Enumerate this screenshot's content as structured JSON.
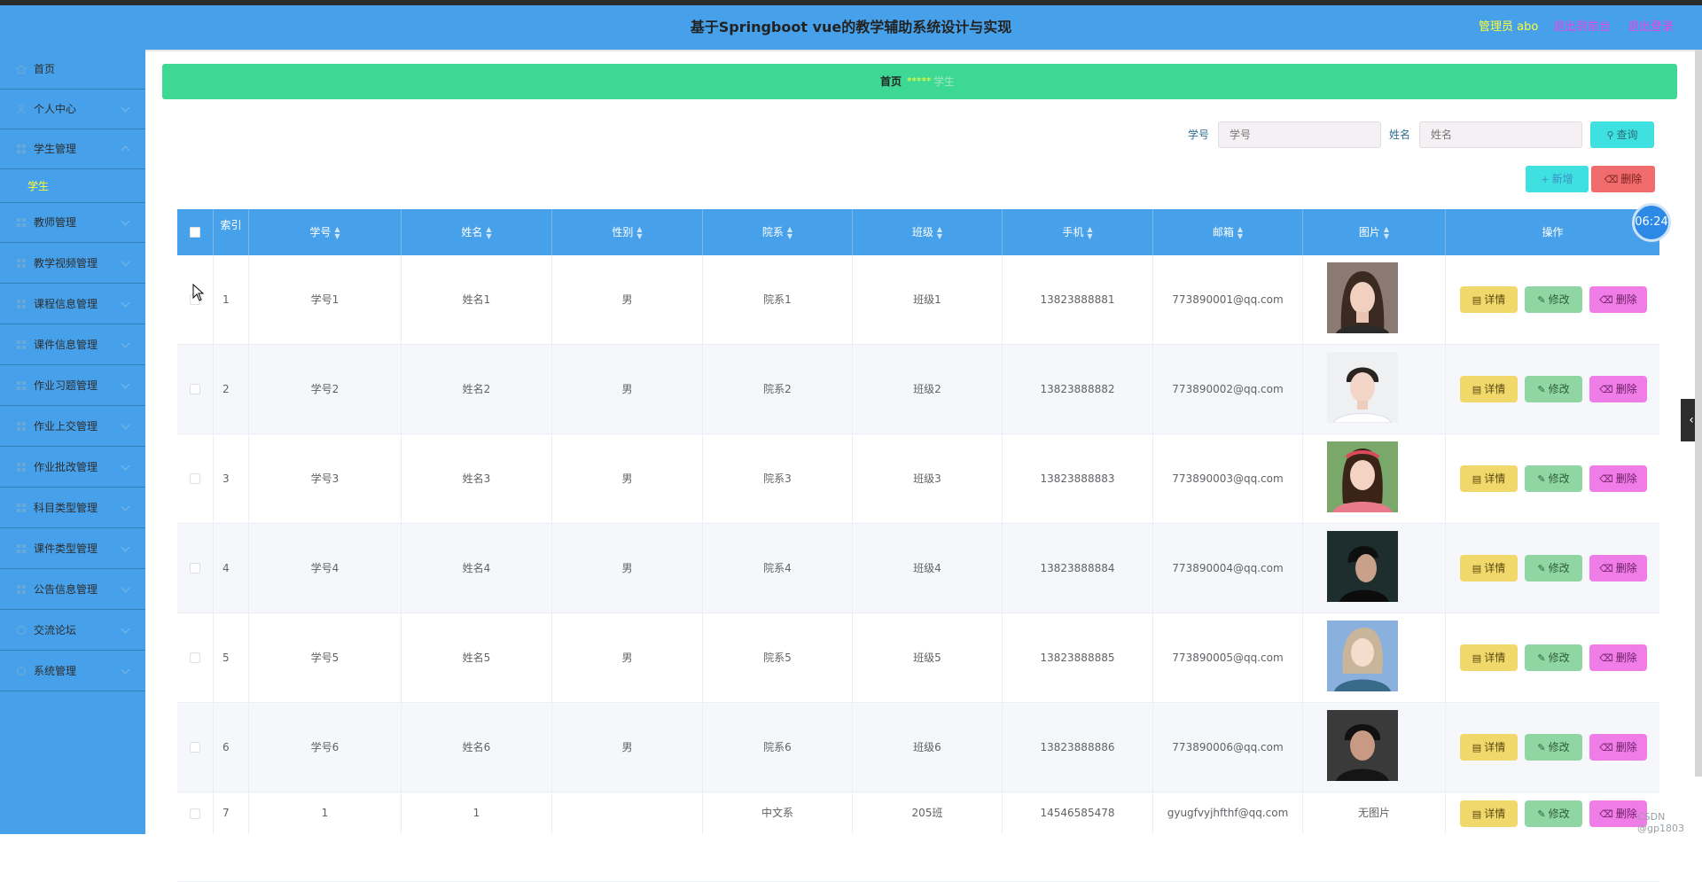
{
  "header": {
    "title": "基于Springboot vue的教学辅助系统设计与实现",
    "admin": "管理员 abo",
    "back_front": "退出到前台",
    "logout": "退出登录"
  },
  "sidebar": {
    "items": [
      {
        "label": "首页",
        "icon": "home-icon"
      },
      {
        "label": "个人中心",
        "icon": "user-icon"
      },
      {
        "label": "学生管理",
        "icon": "grid-icon"
      },
      {
        "label": "教师管理",
        "icon": "grid-icon"
      },
      {
        "label": "教学视频管理",
        "icon": "grid-icon"
      },
      {
        "label": "课程信息管理",
        "icon": "grid-icon"
      },
      {
        "label": "课件信息管理",
        "icon": "grid-icon"
      },
      {
        "label": "作业习题管理",
        "icon": "grid-icon"
      },
      {
        "label": "作业上交管理",
        "icon": "grid-icon"
      },
      {
        "label": "作业批改管理",
        "icon": "grid-icon"
      },
      {
        "label": "科目类型管理",
        "icon": "grid-icon"
      },
      {
        "label": "课件类型管理",
        "icon": "grid-icon"
      },
      {
        "label": "公告信息管理",
        "icon": "grid-icon"
      },
      {
        "label": "交流论坛",
        "icon": "grid-icon"
      },
      {
        "label": "系统管理",
        "icon": "grid-icon"
      }
    ],
    "sub_item": "学生"
  },
  "breadcrumb": {
    "home": "首页",
    "separator": "*****",
    "current": "学生"
  },
  "search": {
    "xuehao_label": "学号",
    "xuehao_placeholder": "学号",
    "xingming_label": "姓名",
    "xingming_placeholder": "姓名",
    "query_button": "查询"
  },
  "actions": {
    "add": "新增",
    "delete": "删除"
  },
  "table": {
    "columns": [
      "索引",
      "学号",
      "姓名",
      "性别",
      "院系",
      "班级",
      "手机",
      "邮箱",
      "图片",
      "操作"
    ],
    "rows": [
      {
        "index": "1",
        "xuehao": "学号1",
        "xingming": "姓名1",
        "gender": "男",
        "dept": "院系1",
        "class": "班级1",
        "phone": "13823888881",
        "email": "773890001@qq.com",
        "photo": "avatar-woman-1"
      },
      {
        "index": "2",
        "xuehao": "学号2",
        "xingming": "姓名2",
        "gender": "男",
        "dept": "院系2",
        "class": "班级2",
        "phone": "13823888882",
        "email": "773890002@qq.com",
        "photo": "avatar-man-1"
      },
      {
        "index": "3",
        "xuehao": "学号3",
        "xingming": "姓名3",
        "gender": "男",
        "dept": "院系3",
        "class": "班级3",
        "phone": "13823888883",
        "email": "773890003@qq.com",
        "photo": "avatar-woman-2"
      },
      {
        "index": "4",
        "xuehao": "学号4",
        "xingming": "姓名4",
        "gender": "男",
        "dept": "院系4",
        "class": "班级4",
        "phone": "13823888884",
        "email": "773890004@qq.com",
        "photo": "avatar-man-2"
      },
      {
        "index": "5",
        "xuehao": "学号5",
        "xingming": "姓名5",
        "gender": "男",
        "dept": "院系5",
        "class": "班级5",
        "phone": "13823888885",
        "email": "773890005@qq.com",
        "photo": "avatar-woman-3"
      },
      {
        "index": "6",
        "xuehao": "学号6",
        "xingming": "姓名6",
        "gender": "男",
        "dept": "院系6",
        "class": "班级6",
        "phone": "13823888886",
        "email": "773890006@qq.com",
        "photo": "avatar-man-3"
      },
      {
        "index": "7",
        "xuehao": "1",
        "xingming": "1",
        "gender": "",
        "dept": "中文系",
        "class": "205班",
        "phone": "14546585478",
        "email": "gyugfvyjhfthf@qq.com",
        "photo_text": "无图片"
      }
    ],
    "row_actions": {
      "detail": "详情",
      "edit": "修改",
      "delete": "删除"
    }
  },
  "clock": "06:24",
  "watermark": "CSDN @gp1803",
  "colors": {
    "header": "#47a1ea",
    "breadcrumb": "#3dd994",
    "detail_button": "#f0d86a",
    "edit_button": "#8fd6a2",
    "delete_button": "#f07ce8",
    "add_button": "#3ee0e0",
    "batch_delete_button": "#f06b6b"
  }
}
